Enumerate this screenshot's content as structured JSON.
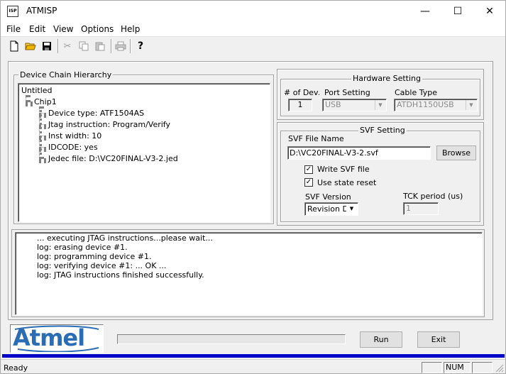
{
  "window": {
    "title": "ATMISP",
    "app_icon_text": "ISP",
    "minimize": "—",
    "maximize": "☐",
    "close": "✕"
  },
  "menu": [
    "File",
    "Edit",
    "View",
    "Options",
    "Help"
  ],
  "toolbar": {
    "icons": [
      "new-file-icon",
      "open-folder-icon",
      "save-icon",
      "cut-icon",
      "copy-icon",
      "paste-icon",
      "print-icon",
      "help-icon"
    ],
    "help_glyph": "?"
  },
  "device_chain": {
    "title": "Device Chain Hierarchy",
    "root": "Untitled",
    "chip": "Chip1",
    "properties": [
      "Device type: ATF1504AS",
      "Jtag instruction: Program/Verify",
      "Inst width: 10",
      "IDCODE: yes",
      "Jedec file: D:\\VC20FINAL-V3-2.jed"
    ]
  },
  "hardware": {
    "title": "Hardware Setting",
    "num_dev_label": "# of Dev.",
    "num_dev_value": "1",
    "port_label": "Port Setting",
    "port_value": "USB",
    "cable_label": "Cable Type",
    "cable_value": "ATDH1150USB"
  },
  "svf": {
    "title": "SVF Setting",
    "file_label": "SVF File Name",
    "file_value": "D:\\VC20FINAL-V3-2.svf",
    "browse": "Browse",
    "write_svf": "Write SVF file",
    "write_svf_checked": true,
    "state_reset": "Use state reset",
    "state_reset_checked": true,
    "version_label": "SVF Version",
    "version_value": "Revision D",
    "tck_label": "TCK period (us)",
    "tck_value": "1"
  },
  "log": [
    "...  executing JTAG instructions...please wait...",
    "log: erasing device #1.",
    "log: programming device #1.",
    "log: verifying device #1: ... OK ...",
    "log: JTAG instructions finished successfully."
  ],
  "footer": {
    "logo": "Atmel",
    "run": "Run",
    "exit": "Exit",
    "accent_color": "#0000c8"
  },
  "status": {
    "text": "Ready",
    "num": "NUM"
  }
}
